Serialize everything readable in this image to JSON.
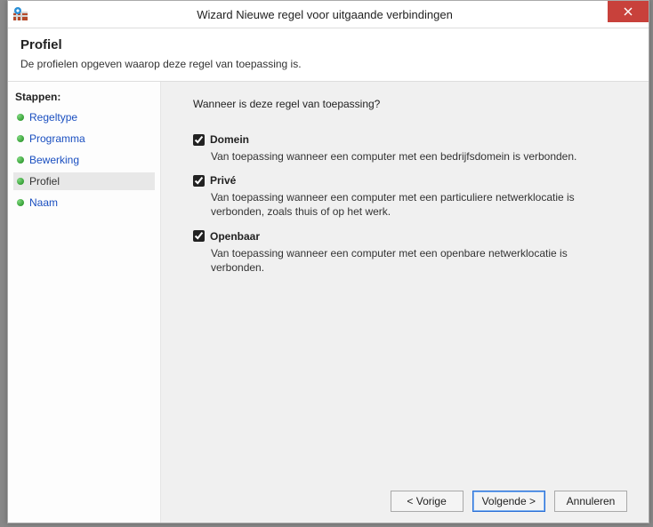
{
  "window": {
    "title": "Wizard Nieuwe regel voor uitgaande verbindingen"
  },
  "header": {
    "title": "Profiel",
    "description": "De profielen opgeven waarop deze regel van toepassing is."
  },
  "sidebar": {
    "title": "Stappen:",
    "items": [
      {
        "label": "Regeltype",
        "active": false
      },
      {
        "label": "Programma",
        "active": false
      },
      {
        "label": "Bewerking",
        "active": false
      },
      {
        "label": "Profiel",
        "active": true
      },
      {
        "label": "Naam",
        "active": false
      }
    ]
  },
  "content": {
    "question": "Wanneer is deze regel van toepassing?",
    "options": [
      {
        "label": "Domein",
        "checked": true,
        "description": "Van toepassing wanneer een computer met een bedrijfsdomein is verbonden."
      },
      {
        "label": "Privé",
        "checked": true,
        "description": "Van toepassing wanneer een computer met een particuliere netwerklocatie is verbonden, zoals thuis of op het werk."
      },
      {
        "label": "Openbaar",
        "checked": true,
        "description": "Van toepassing wanneer een computer met een openbare netwerklocatie is verbonden."
      }
    ]
  },
  "buttons": {
    "back": "< Vorige",
    "next": "Volgende >",
    "cancel": "Annuleren"
  }
}
